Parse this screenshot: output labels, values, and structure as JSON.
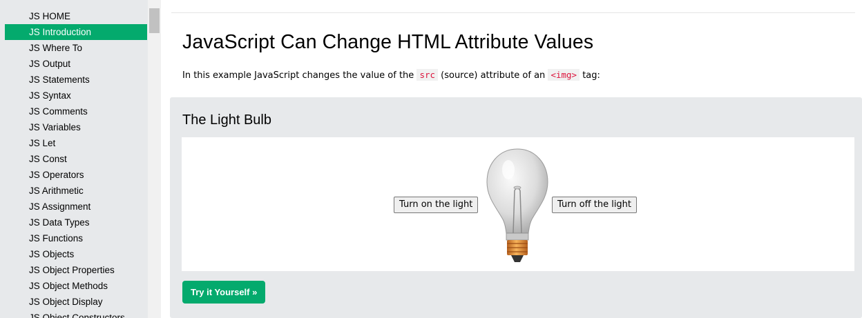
{
  "sidebar": {
    "active_index": 1,
    "items": [
      {
        "label": "JS HOME"
      },
      {
        "label": "JS Introduction"
      },
      {
        "label": "JS Where To"
      },
      {
        "label": "JS Output"
      },
      {
        "label": "JS Statements"
      },
      {
        "label": "JS Syntax"
      },
      {
        "label": "JS Comments"
      },
      {
        "label": "JS Variables"
      },
      {
        "label": "JS Let"
      },
      {
        "label": "JS Const"
      },
      {
        "label": "JS Operators"
      },
      {
        "label": "JS Arithmetic"
      },
      {
        "label": "JS Assignment"
      },
      {
        "label": "JS Data Types"
      },
      {
        "label": "JS Functions"
      },
      {
        "label": "JS Objects"
      },
      {
        "label": "JS Object Properties"
      },
      {
        "label": "JS Object Methods"
      },
      {
        "label": "JS Object Display"
      },
      {
        "label": "JS Object Constructors"
      }
    ]
  },
  "main": {
    "title": "JavaScript Can Change HTML Attribute Values",
    "intro": {
      "part1": "In this example JavaScript changes the value of the ",
      "code1": "src",
      "part2": " (source) attribute of an ",
      "code2": "<img>",
      "part3": " tag:"
    },
    "example": {
      "title": "The Light Bulb",
      "btn_on": "Turn on the light",
      "btn_off": "Turn off the light",
      "bulb_icon": "lightbulb-off-icon",
      "try_label": "Try it Yourself »"
    }
  },
  "colors": {
    "accent": "#04aa6d",
    "sidebar_bg": "#e7e9eb",
    "code_text": "#dc143c"
  }
}
